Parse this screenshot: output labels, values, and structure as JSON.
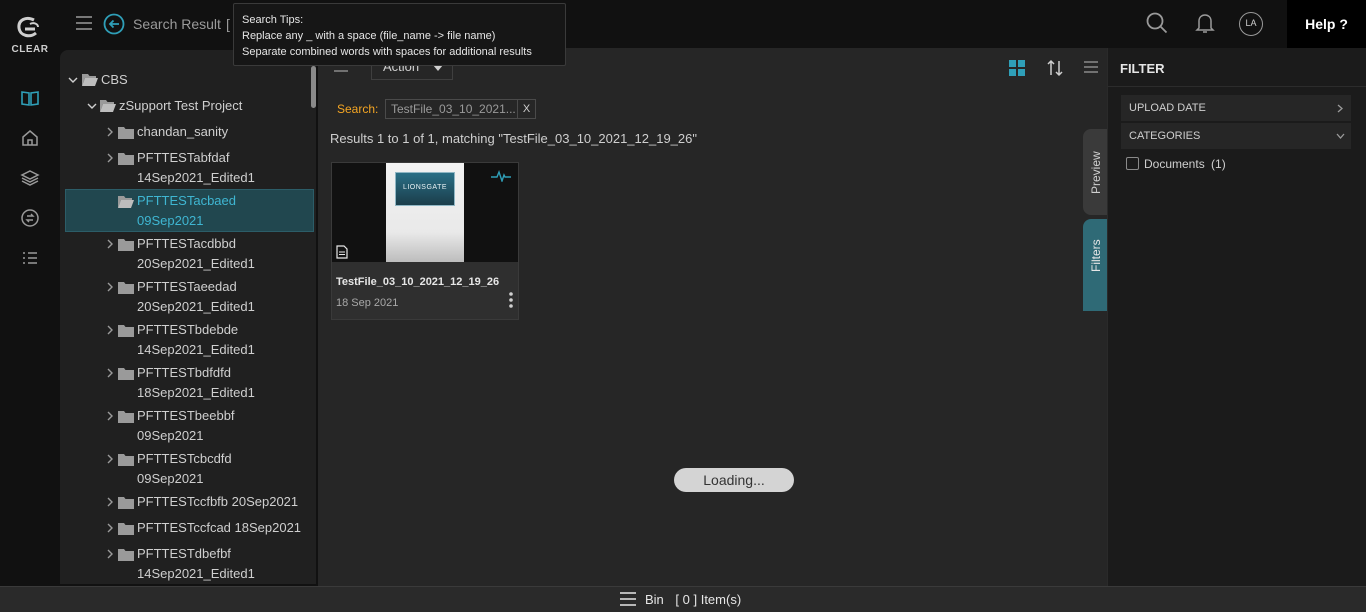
{
  "app": {
    "logo_text": "CLEAR"
  },
  "header": {
    "search_result_label": "Search Result",
    "bracket_text": "[",
    "avatar_initials": "LA",
    "help_label": "Help ?"
  },
  "tooltip": {
    "title": "Search Tips:",
    "line1": "Replace any _ with a space (file_name -> file name)",
    "line2": "Separate combined words with spaces for additional results"
  },
  "tree": {
    "root": "CBS",
    "project": "zSupport Test Project",
    "items": [
      {
        "line1": "chandan_sanity",
        "line2": ""
      },
      {
        "line1": "PFTTESTabfdaf",
        "line2": "14Sep2021_Edited1"
      },
      {
        "line1": "PFTTESTacbaed",
        "line2": "09Sep2021"
      },
      {
        "line1": "PFTTESTacdbbd",
        "line2": "20Sep2021_Edited1"
      },
      {
        "line1": "PFTTESTaeedad",
        "line2": "20Sep2021_Edited1"
      },
      {
        "line1": "PFTTESTbdebde",
        "line2": "14Sep2021_Edited1"
      },
      {
        "line1": "PFTTESTbdfdfd",
        "line2": "18Sep2021_Edited1"
      },
      {
        "line1": "PFTTESTbeebbf",
        "line2": "09Sep2021"
      },
      {
        "line1": "PFTTESTcbcdfd",
        "line2": "09Sep2021"
      },
      {
        "line1": "PFTTESTccfbfb 20Sep2021",
        "line2": ""
      },
      {
        "line1": "PFTTESTccfcad 18Sep2021",
        "line2": ""
      },
      {
        "line1": "PFTTESTdbefbf",
        "line2": "14Sep2021_Edited1"
      }
    ]
  },
  "toolbar": {
    "action_label": "Action"
  },
  "search": {
    "label": "Search:",
    "chip_text": "TestFile_03_10_2021...",
    "chip_close": "X",
    "results_text": "Results 1 to 1 of 1, matching \"TestFile_03_10_2021_12_19_26\""
  },
  "card": {
    "thumb_text": "LIONSGATE",
    "title": "TestFile_03_10_2021_12_19_26",
    "date": "18 Sep 2021"
  },
  "side_tabs": {
    "preview": "Preview",
    "filters": "Filters"
  },
  "loading_text": "Loading...",
  "filter": {
    "title": "FILTER",
    "upload_date": "UPLOAD DATE",
    "categories": "CATEGORIES",
    "documents_label": "Documents",
    "documents_count": "(1)"
  },
  "footer": {
    "bin_label": "Bin",
    "bin_count": "[ 0 ] Item(s)"
  },
  "colors": {
    "accent": "#2f9fb8",
    "search_label": "#f5a623",
    "selected_row": "#21474f"
  }
}
